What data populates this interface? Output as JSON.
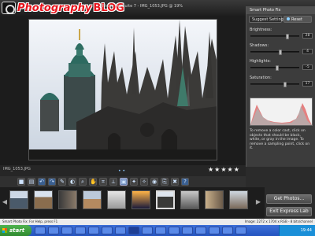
{
  "window": {
    "title": "Photo Pro Suite 7 - IMG_1053.JPG @ 19%"
  },
  "logo": {
    "text_part1": "Photography",
    "text_part2": "BLOG"
  },
  "panel": {
    "title": "Smart Photo Fix",
    "suggest_label": "Suggest Settings",
    "reset_label": "Reset",
    "sliders": [
      {
        "label": "Brightness:",
        "value": "28",
        "level": 0.78
      },
      {
        "label": "Shadows:",
        "value": "4",
        "level": 0.62
      },
      {
        "label": "Highlights:",
        "value": "-5",
        "level": 0.55
      },
      {
        "label": "Saturation:",
        "value": "17",
        "level": 0.72
      }
    ],
    "help_text": "To remove a color cast, click on objects that should be black, white, or gray in the image. To remove a sampling point, click on it."
  },
  "photo": {
    "filename": "IMG_1053.JPG",
    "nav_dots": "• •",
    "stars": "★★★★★",
    "star_count": 5
  },
  "toolbar": {
    "icons": [
      "save-icon",
      "print-icon",
      "undo-icon",
      "redo-icon",
      "brush-icon",
      "adjust-icon",
      "zoom-icon",
      "hand-icon",
      "crop-icon",
      "straighten-icon",
      "enhance-icon",
      "wand-icon",
      "smart-fix-icon",
      "redeye-icon",
      "clone-icon",
      "delete-icon",
      "help-icon"
    ]
  },
  "filmstrip": {
    "thumbnails": [
      "thumb-1",
      "thumb-2",
      "thumb-3",
      "thumb-4",
      "thumb-5",
      "thumb-6",
      "thumb-7",
      "thumb-8",
      "thumb-9",
      "thumb-10"
    ],
    "selected_index": 6
  },
  "buttons": {
    "get_photos": "Get Photos...",
    "exit_express": "Exit Express Lab"
  },
  "status": {
    "left": "Smart Photo Fix: For Help, press F1",
    "right": "Image: 2272 x 1704 x RGB - 8 bits/channel"
  },
  "taskbar": {
    "start_label": "start",
    "clock": "19:44"
  },
  "colors": {
    "accent": "#e8141c",
    "panel_bg": "#3c3c3c",
    "taskbar_blue": "#2454c0",
    "start_green": "#2f8a2f"
  }
}
